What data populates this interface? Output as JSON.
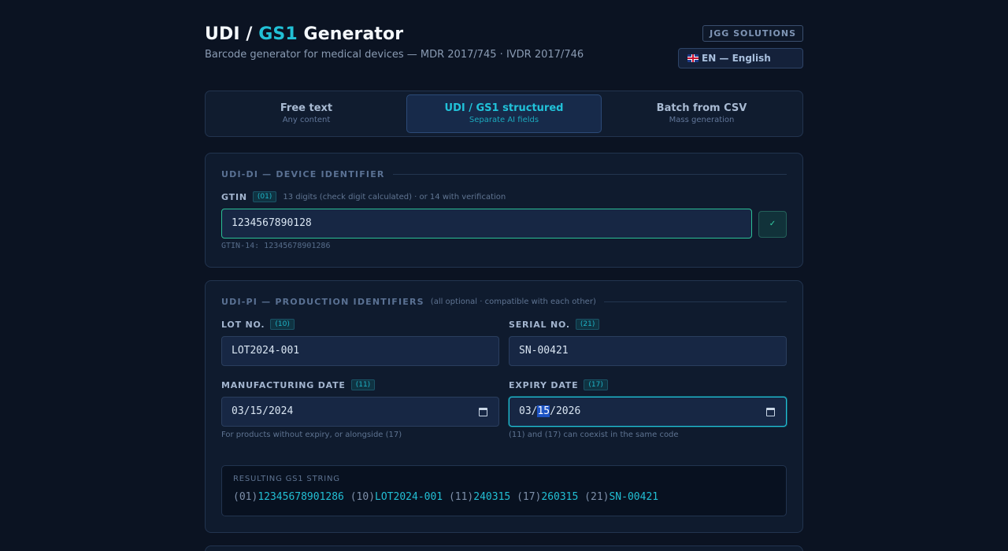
{
  "header": {
    "title_pre": "UDI / ",
    "title_accent": "GS1",
    "title_post": " Generator",
    "subtitle": "Barcode generator for medical devices — MDR 2017/745 · IVDR 2017/746",
    "brand": "JGG SOLUTIONS",
    "language": "EN — English",
    "flag_icon": "uk-flag-icon"
  },
  "tabs": [
    {
      "label": "Free text",
      "sub": "Any content",
      "active": false
    },
    {
      "label": "UDI / GS1 structured",
      "sub": "Separate AI fields",
      "active": true
    },
    {
      "label": "Batch from CSV",
      "sub": "Mass generation",
      "active": false
    }
  ],
  "udi_di": {
    "section_title": "UDI-DI — DEVICE IDENTIFIER",
    "gtin_label": "GTIN",
    "gtin_ai": "(01)",
    "gtin_hint": "13 digits (check digit calculated) · or 14 with verification",
    "gtin_value": "1234567890128",
    "check_icon": "✓",
    "gtin14_note": "GTIN-14: 12345678901286"
  },
  "udi_pi": {
    "section_title": "UDI-PI — PRODUCTION IDENTIFIERS",
    "section_note": "(all optional · compatible with each other)",
    "lot_label": "LOT NO.",
    "lot_ai": "(10)",
    "lot_value": "LOT2024-001",
    "serial_label": "SERIAL NO.",
    "serial_ai": "(21)",
    "serial_value": "SN-00421",
    "mfg_label": "MANUFACTURING DATE",
    "mfg_ai": "(11)",
    "mfg_value": "03/15/2024",
    "mfg_note": "For products without expiry, or alongside (17)",
    "exp_label": "EXPIRY DATE",
    "exp_ai": "(17)",
    "exp_month": "03/",
    "exp_day": "15",
    "exp_year": "/2026",
    "exp_note": "(11) and (17) can coexist in the same code"
  },
  "result": {
    "label": "RESULTING GS1 STRING",
    "parts": [
      {
        "ai": "(01)",
        "val": "12345678901286"
      },
      {
        "ai": "(10)",
        "val": "LOT2024-001"
      },
      {
        "ai": "(11)",
        "val": "240315"
      },
      {
        "ai": "(17)",
        "val": "260315"
      },
      {
        "ai": "(21)",
        "val": "SN-00421"
      }
    ]
  }
}
